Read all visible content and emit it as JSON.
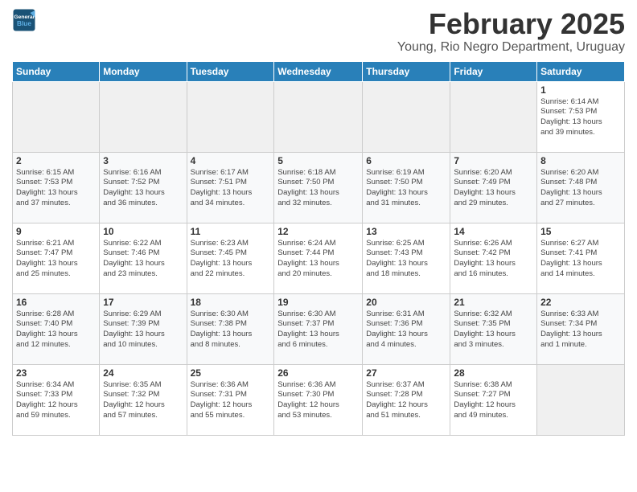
{
  "header": {
    "logo_line1": "General",
    "logo_line2": "Blue",
    "title": "February 2025",
    "subtitle": "Young, Rio Negro Department, Uruguay"
  },
  "days_of_week": [
    "Sunday",
    "Monday",
    "Tuesday",
    "Wednesday",
    "Thursday",
    "Friday",
    "Saturday"
  ],
  "weeks": [
    [
      {
        "day": "",
        "info": ""
      },
      {
        "day": "",
        "info": ""
      },
      {
        "day": "",
        "info": ""
      },
      {
        "day": "",
        "info": ""
      },
      {
        "day": "",
        "info": ""
      },
      {
        "day": "",
        "info": ""
      },
      {
        "day": "1",
        "info": "Sunrise: 6:14 AM\nSunset: 7:53 PM\nDaylight: 13 hours\nand 39 minutes."
      }
    ],
    [
      {
        "day": "2",
        "info": "Sunrise: 6:15 AM\nSunset: 7:53 PM\nDaylight: 13 hours\nand 37 minutes."
      },
      {
        "day": "3",
        "info": "Sunrise: 6:16 AM\nSunset: 7:52 PM\nDaylight: 13 hours\nand 36 minutes."
      },
      {
        "day": "4",
        "info": "Sunrise: 6:17 AM\nSunset: 7:51 PM\nDaylight: 13 hours\nand 34 minutes."
      },
      {
        "day": "5",
        "info": "Sunrise: 6:18 AM\nSunset: 7:50 PM\nDaylight: 13 hours\nand 32 minutes."
      },
      {
        "day": "6",
        "info": "Sunrise: 6:19 AM\nSunset: 7:50 PM\nDaylight: 13 hours\nand 31 minutes."
      },
      {
        "day": "7",
        "info": "Sunrise: 6:20 AM\nSunset: 7:49 PM\nDaylight: 13 hours\nand 29 minutes."
      },
      {
        "day": "8",
        "info": "Sunrise: 6:20 AM\nSunset: 7:48 PM\nDaylight: 13 hours\nand 27 minutes."
      }
    ],
    [
      {
        "day": "9",
        "info": "Sunrise: 6:21 AM\nSunset: 7:47 PM\nDaylight: 13 hours\nand 25 minutes."
      },
      {
        "day": "10",
        "info": "Sunrise: 6:22 AM\nSunset: 7:46 PM\nDaylight: 13 hours\nand 23 minutes."
      },
      {
        "day": "11",
        "info": "Sunrise: 6:23 AM\nSunset: 7:45 PM\nDaylight: 13 hours\nand 22 minutes."
      },
      {
        "day": "12",
        "info": "Sunrise: 6:24 AM\nSunset: 7:44 PM\nDaylight: 13 hours\nand 20 minutes."
      },
      {
        "day": "13",
        "info": "Sunrise: 6:25 AM\nSunset: 7:43 PM\nDaylight: 13 hours\nand 18 minutes."
      },
      {
        "day": "14",
        "info": "Sunrise: 6:26 AM\nSunset: 7:42 PM\nDaylight: 13 hours\nand 16 minutes."
      },
      {
        "day": "15",
        "info": "Sunrise: 6:27 AM\nSunset: 7:41 PM\nDaylight: 13 hours\nand 14 minutes."
      }
    ],
    [
      {
        "day": "16",
        "info": "Sunrise: 6:28 AM\nSunset: 7:40 PM\nDaylight: 13 hours\nand 12 minutes."
      },
      {
        "day": "17",
        "info": "Sunrise: 6:29 AM\nSunset: 7:39 PM\nDaylight: 13 hours\nand 10 minutes."
      },
      {
        "day": "18",
        "info": "Sunrise: 6:30 AM\nSunset: 7:38 PM\nDaylight: 13 hours\nand 8 minutes."
      },
      {
        "day": "19",
        "info": "Sunrise: 6:30 AM\nSunset: 7:37 PM\nDaylight: 13 hours\nand 6 minutes."
      },
      {
        "day": "20",
        "info": "Sunrise: 6:31 AM\nSunset: 7:36 PM\nDaylight: 13 hours\nand 4 minutes."
      },
      {
        "day": "21",
        "info": "Sunrise: 6:32 AM\nSunset: 7:35 PM\nDaylight: 13 hours\nand 3 minutes."
      },
      {
        "day": "22",
        "info": "Sunrise: 6:33 AM\nSunset: 7:34 PM\nDaylight: 13 hours\nand 1 minute."
      }
    ],
    [
      {
        "day": "23",
        "info": "Sunrise: 6:34 AM\nSunset: 7:33 PM\nDaylight: 12 hours\nand 59 minutes."
      },
      {
        "day": "24",
        "info": "Sunrise: 6:35 AM\nSunset: 7:32 PM\nDaylight: 12 hours\nand 57 minutes."
      },
      {
        "day": "25",
        "info": "Sunrise: 6:36 AM\nSunset: 7:31 PM\nDaylight: 12 hours\nand 55 minutes."
      },
      {
        "day": "26",
        "info": "Sunrise: 6:36 AM\nSunset: 7:30 PM\nDaylight: 12 hours\nand 53 minutes."
      },
      {
        "day": "27",
        "info": "Sunrise: 6:37 AM\nSunset: 7:28 PM\nDaylight: 12 hours\nand 51 minutes."
      },
      {
        "day": "28",
        "info": "Sunrise: 6:38 AM\nSunset: 7:27 PM\nDaylight: 12 hours\nand 49 minutes."
      },
      {
        "day": "",
        "info": ""
      }
    ]
  ]
}
